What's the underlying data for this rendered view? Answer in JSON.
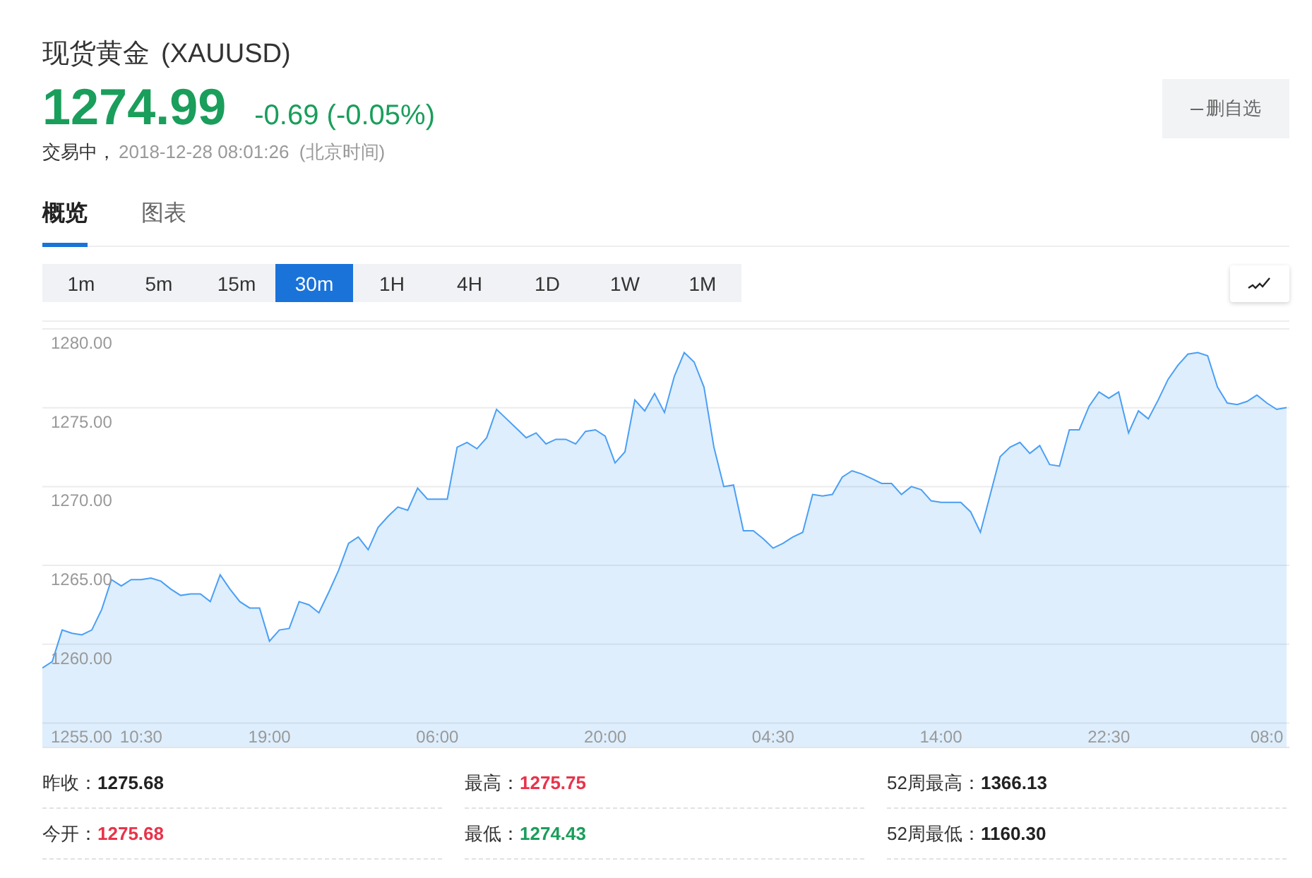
{
  "header": {
    "name": "现货黄金",
    "symbol": "(XAUUSD)",
    "price": "1274.99",
    "change": "-0.69 (-0.05%)",
    "status": "交易中，",
    "time": "2018-12-28 08:01:26  (北京时间)"
  },
  "watch_button": {
    "label": "删自选"
  },
  "tabs": [
    {
      "label": "概览",
      "selected": true
    },
    {
      "label": "图表",
      "selected": false
    }
  ],
  "periods": [
    {
      "label": "1m",
      "selected": false
    },
    {
      "label": "5m",
      "selected": false
    },
    {
      "label": "15m",
      "selected": false
    },
    {
      "label": "30m",
      "selected": true
    },
    {
      "label": "1H",
      "selected": false
    },
    {
      "label": "4H",
      "selected": false
    },
    {
      "label": "1D",
      "selected": false
    },
    {
      "label": "1W",
      "selected": false
    },
    {
      "label": "1M",
      "selected": false
    }
  ],
  "chart": {
    "chart_data": {
      "type": "area",
      "grid": true,
      "categories": [
        null,
        null,
        null,
        null,
        null,
        null,
        null,
        null,
        null,
        null,
        "10:30",
        null,
        null,
        null,
        null,
        null,
        null,
        null,
        null,
        null,
        null,
        null,
        null,
        "19:00",
        null,
        null,
        null,
        null,
        null,
        null,
        null,
        null,
        null,
        null,
        null,
        null,
        null,
        null,
        null,
        null,
        "06:00",
        null,
        null,
        null,
        null,
        null,
        null,
        null,
        null,
        null,
        null,
        null,
        null,
        null,
        null,
        null,
        null,
        "20:00",
        null,
        null,
        null,
        null,
        null,
        null,
        null,
        null,
        null,
        null,
        null,
        null,
        null,
        null,
        null,
        null,
        "04:30",
        null,
        null,
        null,
        null,
        null,
        null,
        null,
        null,
        null,
        null,
        null,
        null,
        null,
        null,
        null,
        null,
        "14:00",
        null,
        null,
        null,
        null,
        null,
        null,
        null,
        null,
        null,
        null,
        null,
        null,
        null,
        null,
        null,
        null,
        "22:30",
        null,
        null,
        null,
        null,
        null,
        null,
        null,
        null,
        null,
        null,
        null,
        null,
        null,
        null,
        null,
        "08:0",
        null,
        null
      ],
      "ylim": [
        1253.5,
        1280
      ],
      "yticks": [
        {
          "value": 1255,
          "label": "1255.00"
        },
        {
          "value": 1260,
          "label": "1260.00"
        },
        {
          "value": 1265,
          "label": "1265.00"
        },
        {
          "value": 1270,
          "label": "1270.00"
        },
        {
          "value": 1275,
          "label": "1275.00"
        },
        {
          "value": 1280,
          "label": "1280.00"
        }
      ],
      "series": [
        {
          "color": "#4a9ff5",
          "values": [
            1258.5,
            1258.9,
            1260.9,
            1260.7,
            1260.6,
            1260.9,
            1262.2,
            1264.1,
            1263.7,
            1264.1,
            1264.1,
            1264.2,
            1264.0,
            1263.5,
            1263.1,
            1263.2,
            1263.2,
            1262.7,
            1264.4,
            1263.5,
            1262.7,
            1262.3,
            1262.3,
            1260.2,
            1260.9,
            1261.0,
            1262.7,
            1262.5,
            1262.0,
            1263.3,
            1264.7,
            1266.4,
            1266.8,
            1266.0,
            1267.4,
            1268.1,
            1268.7,
            1268.5,
            1269.9,
            1269.2,
            1269.2,
            1269.2,
            1272.5,
            1272.8,
            1272.4,
            1273.1,
            1274.9,
            1274.3,
            1273.7,
            1273.1,
            1273.4,
            1272.7,
            1273.0,
            1273.0,
            1272.7,
            1273.5,
            1273.6,
            1273.2,
            1271.5,
            1272.2,
            1275.5,
            1274.8,
            1275.9,
            1274.7,
            1277.0,
            1278.5,
            1277.9,
            1276.3,
            1272.5,
            1270.0,
            1270.1,
            1267.2,
            1267.2,
            1266.7,
            1266.1,
            1266.4,
            1266.8,
            1267.1,
            1269.5,
            1269.4,
            1269.5,
            1270.6,
            1271.0,
            1270.8,
            1270.5,
            1270.2,
            1270.2,
            1269.5,
            1270.0,
            1269.8,
            1269.1,
            1269.0,
            1269.0,
            1269.0,
            1268.4,
            1267.1,
            1269.5,
            1271.9,
            1272.5,
            1272.8,
            1272.1,
            1272.6,
            1271.4,
            1271.3,
            1273.6,
            1273.6,
            1275.1,
            1276.0,
            1275.6,
            1276.0,
            1273.4,
            1274.8,
            1274.3,
            1275.5,
            1276.8,
            1277.7,
            1278.4,
            1278.5,
            1278.3,
            1276.3,
            1275.3,
            1275.2,
            1275.4,
            1275.8,
            1275.3,
            1274.9,
            1275.0
          ]
        }
      ]
    }
  },
  "stats": [
    {
      "label": "昨收：",
      "value": "1275.68",
      "color": "#222222"
    },
    {
      "label": "最高：",
      "value": "1275.75",
      "color": "#e8334a"
    },
    {
      "label": "52周最高：",
      "value": "1366.13",
      "color": "#222222"
    },
    {
      "label": "今开：",
      "value": "1275.68",
      "color": "#e8334a"
    },
    {
      "label": "最低：",
      "value": "1274.43",
      "color": "#1a9e5b"
    },
    {
      "label": "52周最低：",
      "value": "1160.30",
      "color": "#222222"
    }
  ]
}
